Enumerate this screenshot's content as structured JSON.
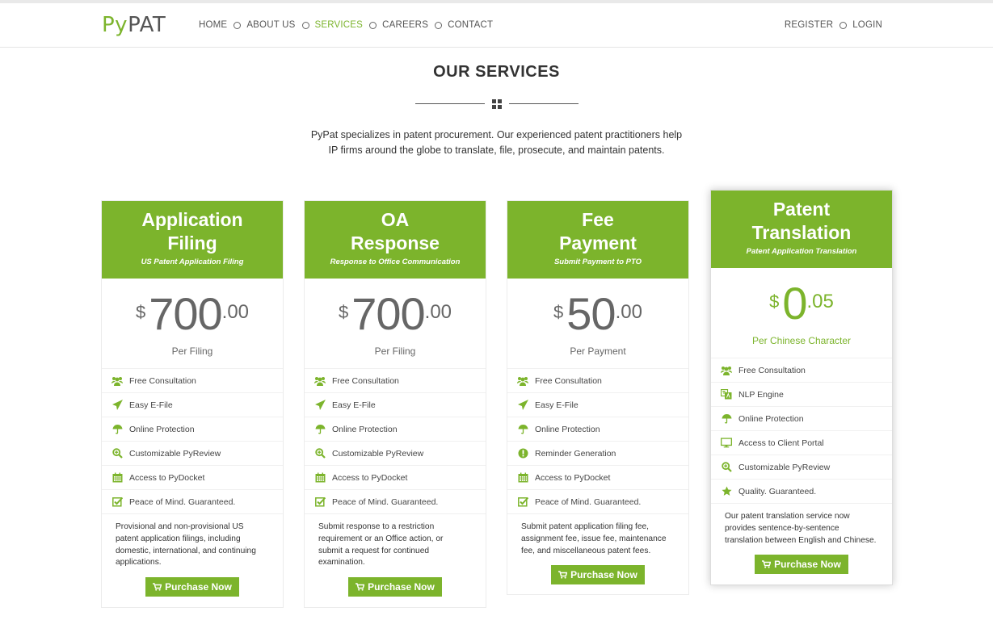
{
  "brand": {
    "logo_py": "Py",
    "logo_pat": "PAT",
    "accent_color": "#7cb42c"
  },
  "nav": [
    {
      "label": "HOME",
      "active": false
    },
    {
      "label": "ABOUT US",
      "active": false
    },
    {
      "label": "SERVICES",
      "active": true
    },
    {
      "label": "CAREERS",
      "active": false
    },
    {
      "label": "CONTACT",
      "active": false
    }
  ],
  "auth": {
    "register": "REGISTER",
    "login": "LOGIN"
  },
  "section": {
    "title": "OUR SERVICES",
    "intro_line1": "PyPat specializes in patent procurement. Our experienced patent practitioners help",
    "intro_line2": "IP firms around the globe to translate, file, prosecute, and maintain patents."
  },
  "cards": [
    {
      "title1": "Application",
      "title2": "Filing",
      "subtitle": "US Patent Application Filing",
      "currency": "$",
      "price_int": "700",
      "price_dec": ".00",
      "per": "Per Filing",
      "features": [
        {
          "icon": "users-icon",
          "label": "Free Consultation"
        },
        {
          "icon": "send-icon",
          "label": "Easy E-File"
        },
        {
          "icon": "umbrella-icon",
          "label": "Online Protection"
        },
        {
          "icon": "zoom-icon",
          "label": "Customizable PyReview"
        },
        {
          "icon": "calendar-icon",
          "label": "Access to PyDocket"
        },
        {
          "icon": "checkbox-icon",
          "label": "Peace of Mind. Guaranteed."
        }
      ],
      "desc_lines": [
        "Provisional and non-provisional US",
        "patent application filings, including",
        "domestic, international, and continuing",
        "applications."
      ],
      "button": "Purchase Now"
    },
    {
      "title1": "OA",
      "title2": "Response",
      "subtitle": "Response to Office Communication",
      "currency": "$",
      "price_int": "700",
      "price_dec": ".00",
      "per": "Per Filing",
      "features": [
        {
          "icon": "users-icon",
          "label": "Free Consultation"
        },
        {
          "icon": "send-icon",
          "label": "Easy E-File"
        },
        {
          "icon": "umbrella-icon",
          "label": "Online Protection"
        },
        {
          "icon": "zoom-icon",
          "label": "Customizable PyReview"
        },
        {
          "icon": "calendar-icon",
          "label": "Access to PyDocket"
        },
        {
          "icon": "checkbox-icon",
          "label": "Peace of Mind. Guaranteed."
        }
      ],
      "desc_lines": [
        "Submit response to a restriction",
        "requirement or an Office action, or",
        "submit a request for continued",
        "examination."
      ],
      "button": "Purchase Now"
    },
    {
      "title1": "Fee",
      "title2": "Payment",
      "subtitle": "Submit Payment to PTO",
      "currency": "$",
      "price_int": "50",
      "price_dec": ".00",
      "per": "Per Payment",
      "features": [
        {
          "icon": "users-icon",
          "label": "Free Consultation"
        },
        {
          "icon": "send-icon",
          "label": "Easy E-File"
        },
        {
          "icon": "umbrella-icon",
          "label": "Online Protection"
        },
        {
          "icon": "alert-icon",
          "label": "Reminder Generation"
        },
        {
          "icon": "calendar-icon",
          "label": "Access to PyDocket"
        },
        {
          "icon": "checkbox-icon",
          "label": "Peace of Mind. Guaranteed."
        }
      ],
      "desc_lines": [
        "Submit patent application filing fee,",
        "assignment fee, issue fee, maintenance",
        "fee, and miscellaneous patent fees."
      ],
      "button": "Purchase Now"
    },
    {
      "title1": "Patent",
      "title2": "Translation",
      "subtitle": "Patent Application Translation",
      "currency": "$",
      "price_int": "0",
      "price_dec": ".05",
      "per": "Per Chinese Character",
      "features": [
        {
          "icon": "users-icon",
          "label": "Free Consultation"
        },
        {
          "icon": "translate-icon",
          "label": "NLP Engine"
        },
        {
          "icon": "umbrella-icon",
          "label": "Online Protection"
        },
        {
          "icon": "monitor-icon",
          "label": "Access to Client Portal"
        },
        {
          "icon": "zoom-icon",
          "label": "Customizable PyReview"
        },
        {
          "icon": "star-icon",
          "label": "Quality. Guaranteed."
        }
      ],
      "desc_lines": [
        "Our patent translation service now",
        "provides sentence-by-sentence",
        "translation between English and Chinese."
      ],
      "button": "Purchase Now"
    }
  ]
}
